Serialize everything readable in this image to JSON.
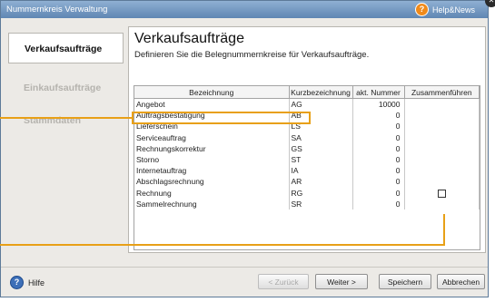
{
  "window": {
    "title": "Nummernkreis Verwaltung",
    "help_news": "Help&News",
    "help_icon_glyph": "?",
    "close_glyph": "✕"
  },
  "nav": {
    "items": [
      {
        "label": "Verkaufsaufträge",
        "active": true
      },
      {
        "label": "Einkaufsaufträge",
        "active": false
      },
      {
        "label": "Stammdaten",
        "active": false
      }
    ]
  },
  "main": {
    "title": "Verkaufsaufträge",
    "subtitle": "Definieren Sie die Belegnummernkreise für Verkaufsaufträge."
  },
  "table": {
    "columns": [
      "Bezeichnung",
      "Kurzbezeichnung",
      "akt. Nummer",
      "Zusammenführen"
    ],
    "rows": [
      {
        "name": "Angebot",
        "short": "AG",
        "number": "10000",
        "merge": false
      },
      {
        "name": "Auftragsbestätigung",
        "short": "AB",
        "number": "0",
        "merge": false
      },
      {
        "name": "Lieferschein",
        "short": "LS",
        "number": "0",
        "merge": false
      },
      {
        "name": "Serviceauftrag",
        "short": "SA",
        "number": "0",
        "merge": false
      },
      {
        "name": "Rechnungskorrektur",
        "short": "GS",
        "number": "0",
        "merge": false
      },
      {
        "name": "Storno",
        "short": "ST",
        "number": "0",
        "merge": false
      },
      {
        "name": "Internetauftrag",
        "short": "IA",
        "number": "0",
        "merge": false
      },
      {
        "name": "Abschlagsrechnung",
        "short": "AR",
        "number": "0",
        "merge": false
      },
      {
        "name": "Rechnung",
        "short": "RG",
        "number": "0",
        "merge": true
      },
      {
        "name": "Sammelrechnung",
        "short": "SR",
        "number": "0",
        "merge": false
      }
    ]
  },
  "footer": {
    "help_label": "Hilfe",
    "help_icon_glyph": "?",
    "back_label": "< Zurück",
    "next_label": "Weiter >",
    "save_label": "Speichern",
    "cancel_label": "Abbrechen"
  },
  "colors": {
    "titlebar": "#6f95c0",
    "accent_highlight": "#e8a017",
    "help_orange": "#f08a1a",
    "help_blue": "#3d6fb8"
  }
}
